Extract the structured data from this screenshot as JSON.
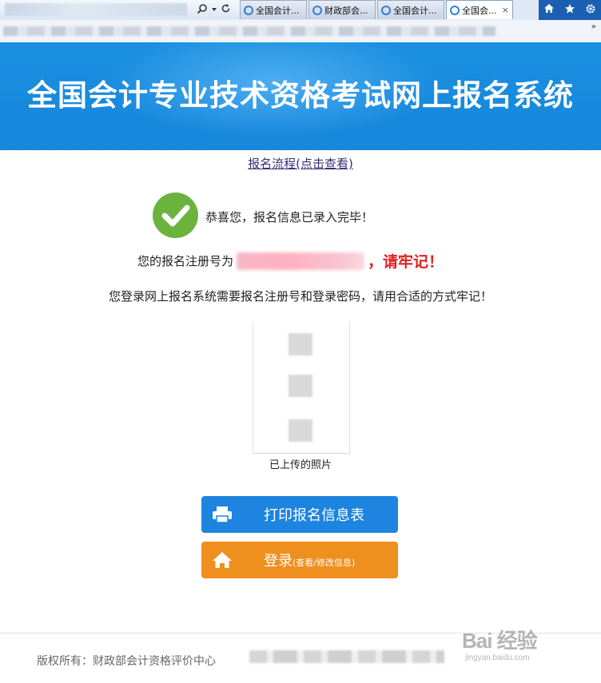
{
  "browser": {
    "tabs": [
      {
        "label": "全国会计...",
        "active": false
      },
      {
        "label": "财政部会...",
        "active": false
      },
      {
        "label": "全国会计...",
        "active": false
      },
      {
        "label": "全国会...",
        "active": true
      }
    ],
    "close_glyph": "×",
    "more_glyph": "»",
    "icons": [
      "search-icon",
      "refresh-icon",
      "home-icon",
      "favorites-star-icon",
      "settings-gear-icon"
    ]
  },
  "banner": {
    "title": "全国会计专业技术资格考试网上报名系统",
    "color": "#1a8fe0"
  },
  "process_link": "报名流程(点击查看)",
  "success": {
    "icon": "checkmark-icon",
    "message": "恭喜您，报名信息已录入完毕！",
    "color": "#6cb33e"
  },
  "registration": {
    "prefix": "您的报名注册号为",
    "warning": "，请牢记！",
    "warning_color": "#e02020"
  },
  "login_note": "您登录网上报名系统需要报名注册号和登录密码，请用合适的方式牢记！",
  "photo": {
    "caption": "已上传的照片"
  },
  "buttons": {
    "print": {
      "label": "打印报名信息表",
      "icon": "printer-icon",
      "color": "#1d84df"
    },
    "login": {
      "label": "登录",
      "sub": "(查看/修改信息)",
      "icon": "home-icon",
      "color": "#ef8f1e"
    }
  },
  "footer": {
    "copyright": "版权所有：财政部会计资格评价中心"
  },
  "watermark": {
    "main": "Bai 经验",
    "sub": "jingyan.baidu.com"
  }
}
